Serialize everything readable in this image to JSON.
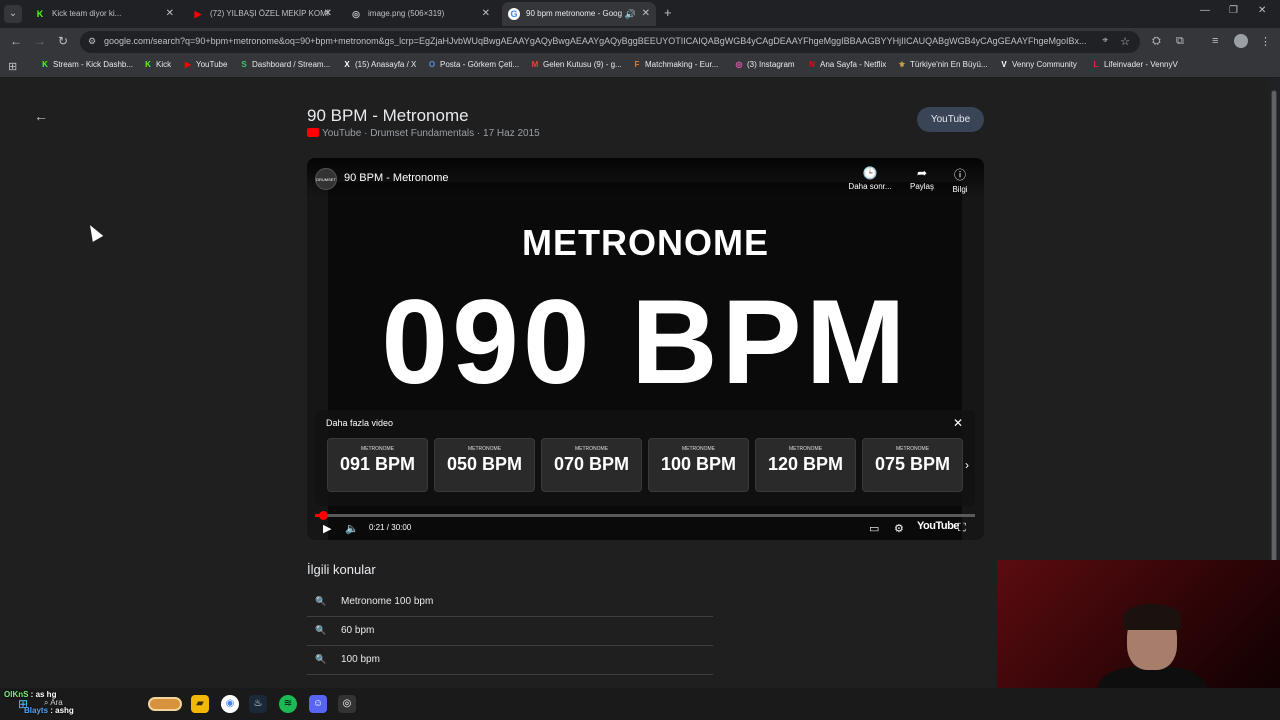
{
  "tabs": [
    {
      "title": "Kick team diyor ki...",
      "fav_color": "#53fc18",
      "fav_glyph": "K"
    },
    {
      "title": "(72) YILBAŞI ÖZEL MEKİP KOMİ",
      "fav_color": "#ff0000",
      "fav_glyph": "▶"
    },
    {
      "title": "image.png (506×319)",
      "fav_color": "#5f6368",
      "fav_glyph": "◎"
    },
    {
      "title": "90 bpm metronome - Goog",
      "fav_color": "#4285f4",
      "fav_glyph": "G"
    }
  ],
  "url": "google.com/search?q=90+bpm+metronome&oq=90+bpm+metronom&gs_lcrp=EgZjaHJvbWUqBwgAEAAYgAQyBwgAEAAYgAQyBggBEEUYOTIICAIQABgWGB4yCAgDEAAYFhgeMggIBBAAGBYYHjIICAUQABgWGB4yCAgGEAAYFhgeMgoIBx...",
  "bookmarks": [
    {
      "label": "Stream - Kick Dashb...",
      "color": "#53fc18",
      "glyph": "K"
    },
    {
      "label": "Kick",
      "color": "#53fc18",
      "glyph": "K"
    },
    {
      "label": "YouTube",
      "color": "#ff0000",
      "glyph": "▶"
    },
    {
      "label": "Dashboard / Stream...",
      "color": "#3ec46d",
      "glyph": "S"
    },
    {
      "label": "(15) Anasayfa / X",
      "color": "#000000",
      "glyph": "X"
    },
    {
      "label": "Posta - Görkem Çeti...",
      "color": "#0a64d6",
      "glyph": "O"
    },
    {
      "label": "Gelen Kutusu (9) - g...",
      "color": "#ea4335",
      "glyph": "M"
    },
    {
      "label": "Matchmaking - Eur...",
      "color": "#444444",
      "glyph": "F"
    },
    {
      "label": "(3) Instagram",
      "color": "#c13584",
      "glyph": "◎"
    },
    {
      "label": "Ana Sayfa - Netflix",
      "color": "#e50914",
      "glyph": "N"
    },
    {
      "label": "Türkiye'nin En Büyü...",
      "color": "#8a6d1e",
      "glyph": "⚜"
    },
    {
      "label": "Venny Community",
      "color": "#555555",
      "glyph": "V"
    },
    {
      "label": "Lifeinvader - VennyV",
      "color": "#e0283a",
      "glyph": "L"
    }
  ],
  "video": {
    "title": "90 BPM - Metronome",
    "source": "YouTube",
    "meta": "Drumset Fundamentals · 17 Haz 2015",
    "youtube_button": "YouTube",
    "player_title": "90 BPM - Metronome",
    "watch_later": "Daha sonr...",
    "share": "Paylaş",
    "info": "Bilgi",
    "headline": "METRONOME",
    "big_text": "090 BPM",
    "more_videos_label": "Daha fazla video",
    "suggestions": [
      {
        "small": "METRONOME",
        "big": "091 BPM"
      },
      {
        "small": "METRONOME",
        "big": "050 BPM"
      },
      {
        "small": "METRONOME",
        "big": "070 BPM"
      },
      {
        "small": "METRONOME",
        "big": "100 BPM"
      },
      {
        "small": "METRONOME",
        "big": "120 BPM"
      },
      {
        "small": "METRONOME",
        "big": "075 BPM"
      }
    ],
    "time": "0:21 / 30:00",
    "progress_fraction": 0.0117,
    "youtube_logo": "YouTube",
    "channel_logo": "DRUMSET"
  },
  "related": {
    "title": "İlgili konular",
    "items": [
      "Metronome 100 bpm",
      "60 bpm",
      "100 bpm"
    ]
  },
  "chat": [
    {
      "name": "OlKnS",
      "text": " : as hg"
    },
    {
      "name": "Blayts",
      "text": " : ashg"
    }
  ],
  "taskbar": {
    "search": "Ara"
  },
  "colors": {
    "accent_red": "#ff0000",
    "youtube_btn_bg": "#394457"
  }
}
